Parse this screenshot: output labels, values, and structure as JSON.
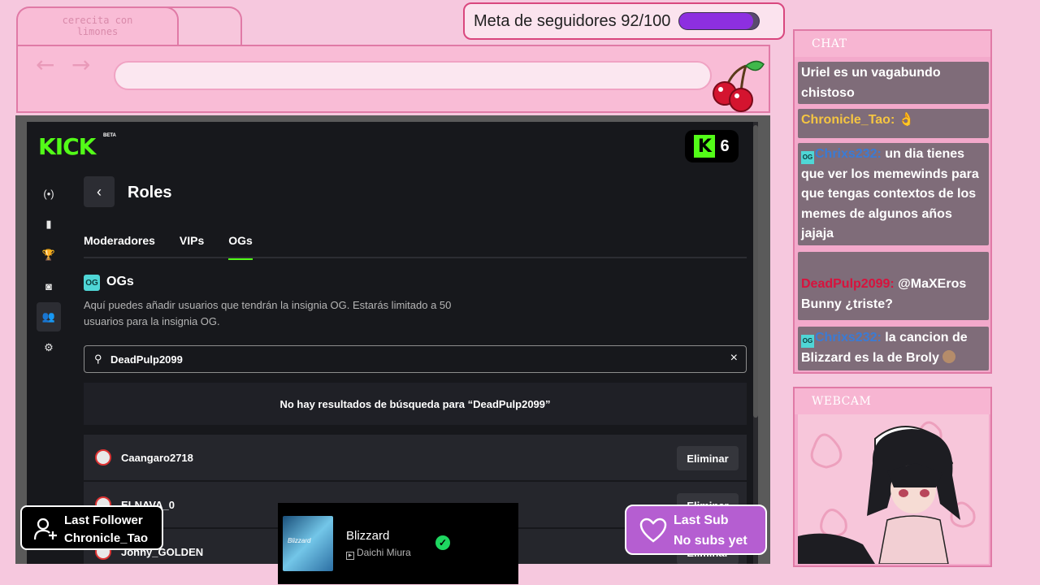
{
  "browser": {
    "tab_title": "cerecita con limones",
    "back_glyph": "←",
    "forward_glyph": "→",
    "address_value": ""
  },
  "goal": {
    "text": "Meta de seguidores 92/100",
    "progress": 0.92,
    "bar_color": "#8d2fe0"
  },
  "kick": {
    "logo": "KICK",
    "beta": "BETA",
    "viewer_count": "6",
    "accent": "#53fc18",
    "sidebar_icons": [
      "broadcast-icon",
      "chart-icon",
      "trophy-icon",
      "camera-icon",
      "users-icon",
      "gear-icon"
    ],
    "page_title": "Roles",
    "tabs": [
      {
        "label": "Moderadores"
      },
      {
        "label": "VIPs"
      },
      {
        "label": "OGs"
      }
    ],
    "section_title": "OGs",
    "og_badge": "OG",
    "description": "Aquí puedes añadir usuarios que tendrán la insignia OG. Estarás limitado a 50 usuarios para la insignia OG.",
    "search_value": "DeadPulp2099",
    "no_results": "No hay resultados de búsqueda para “DeadPulp2099”",
    "users": [
      {
        "name": "Caangaro2718",
        "action": "Eliminar"
      },
      {
        "name": "ELNAVA_0",
        "action": "Eliminar"
      },
      {
        "name": "Jonny_GOLDEN",
        "action": "Eliminar"
      }
    ]
  },
  "follower": {
    "label": "Last Follower",
    "name": "Chronicle_Tao"
  },
  "player": {
    "album_text": "Blizzard",
    "song": "Blizzard",
    "artist": "Daichi Miura"
  },
  "sub": {
    "label": "Last Sub",
    "value": "No subs yet"
  },
  "chat": {
    "title": "CHAT",
    "messages": [
      {
        "user": "",
        "text": "Uriel es un vagabundo chistoso"
      },
      {
        "user": "Chronicle_Tao:",
        "text": "👌"
      },
      {
        "user": "Chrixs232:",
        "text": "un dia tienes que ver los memewinds para que tengas contextos de los memes de algunos años jajaja"
      },
      {
        "user": "DeadPulp2099:",
        "text": "@MaXEros Bunny ¿triste?"
      },
      {
        "user": "Chrixs232:",
        "text": "la cancion de Blizzard es la de Broly"
      }
    ]
  },
  "webcam": {
    "title": "WEBCAM"
  }
}
